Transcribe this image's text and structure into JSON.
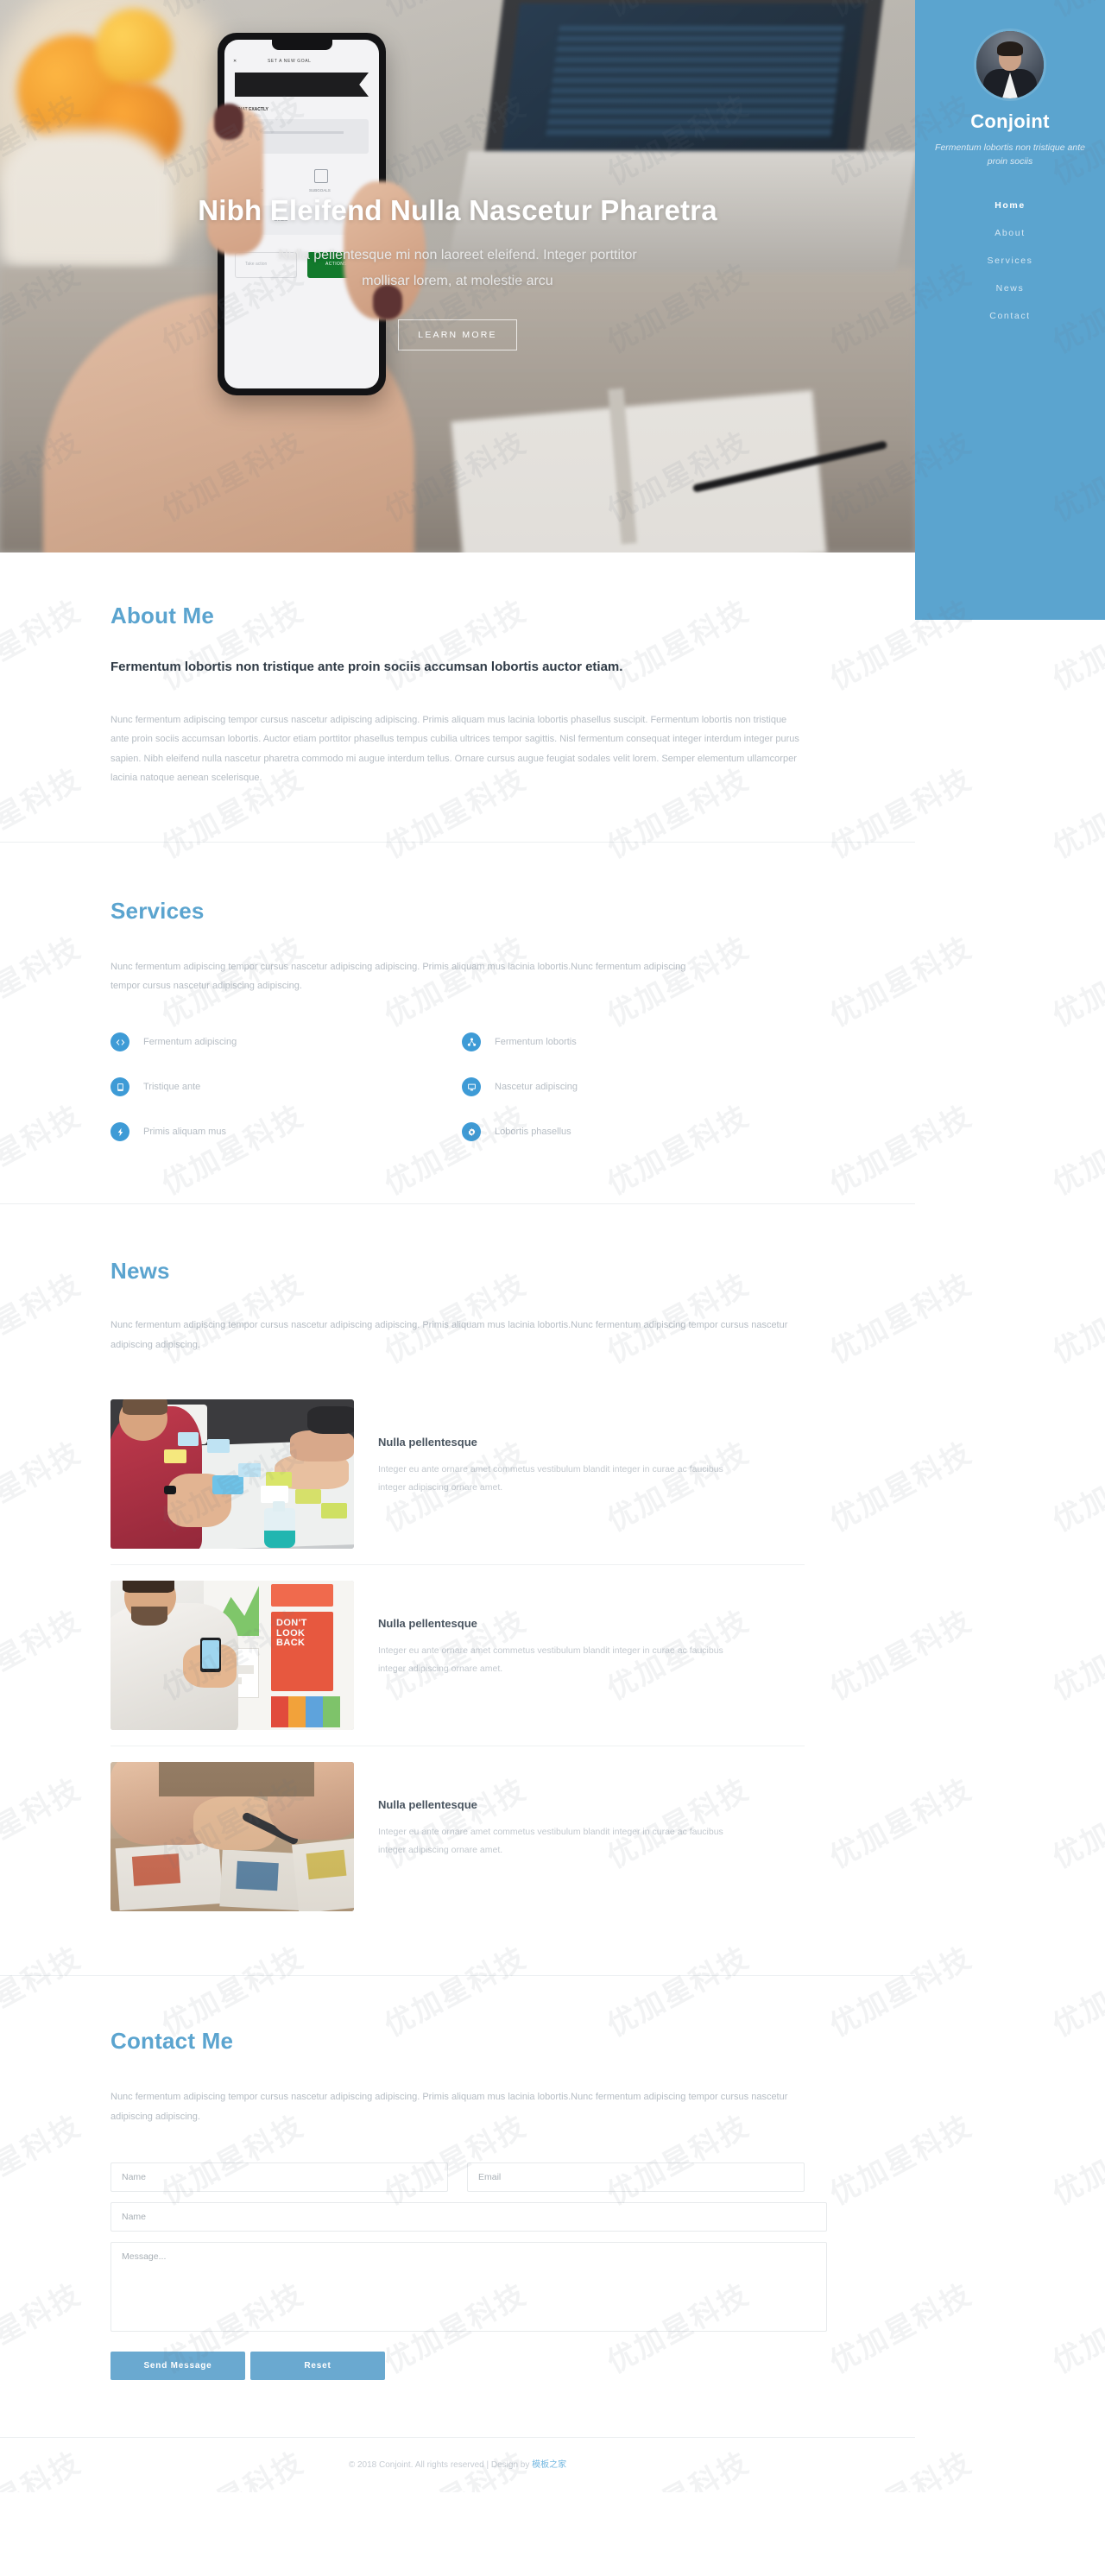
{
  "sidebar": {
    "brand": "Conjoint",
    "tagline": "Fermentum lobortis non tristique ante proin sociis",
    "nav": [
      {
        "label": "Home",
        "active": true
      },
      {
        "label": "About",
        "active": false
      },
      {
        "label": "Services",
        "active": false
      },
      {
        "label": "News",
        "active": false
      },
      {
        "label": "Contact",
        "active": false
      }
    ],
    "avatar_name": "profile-avatar",
    "bg_color": "#5ba4cf"
  },
  "hero": {
    "title": "Nibh Eleifend Nulla Nascetur Pharetra",
    "subtitle": "Nulla pellentesque mi non laoreet eleifend. Integer porttitor mollisar lorem, at molestie arcu",
    "button": "LEARN MORE"
  },
  "about": {
    "title": "About Me",
    "lead": "Fermentum lobortis non tristique ante proin sociis accumsan lobortis auctor etiam.",
    "paragraph": "Nunc fermentum adipiscing tempor cursus nascetur adipiscing adipiscing. Primis aliquam mus lacinia lobortis phasellus suscipit. Fermentum lobortis non tristique ante proin sociis accumsan lobortis. Auctor etiam porttitor phasellus tempus cubilia ultrices tempor sagittis. Nisl fermentum consequat integer interdum integer purus sapien. Nibh eleifend nulla nascetur pharetra commodo mi augue interdum tellus. Ornare cursus augue feugiat sodales velit lorem. Semper elementum ullamcorper lacinia natoque aenean scelerisque."
  },
  "services": {
    "title": "Services",
    "paragraph": "Nunc fermentum adipiscing tempor cursus nascetur adipiscing adipiscing. Primis aliquam mus lacinia lobortis.Nunc fermentum adipiscing tempor cursus nascetur adipiscing adipiscing.",
    "accent": "#3e9bd6",
    "items": [
      {
        "label": "Fermentum adipiscing",
        "icon": "code-icon"
      },
      {
        "label": "Fermentum lobortis",
        "icon": "share-nodes-icon"
      },
      {
        "label": "Tristique ante",
        "icon": "tablet-icon"
      },
      {
        "label": "Nascetur adipiscing",
        "icon": "desktop-icon"
      },
      {
        "label": "Primis aliquam mus",
        "icon": "bolt-icon"
      },
      {
        "label": "Lobortis phasellus",
        "icon": "gear-icon"
      }
    ]
  },
  "news": {
    "title": "News",
    "paragraph": "Nunc fermentum adipiscing tempor cursus nascetur adipiscing adipiscing. Primis aliquam mus lacinia lobortis.Nunc fermentum adipiscing tempor cursus nascetur adipiscing adipiscing.",
    "items": [
      {
        "heading": "Nulla pellentesque",
        "text": "Integer eu ante ornare amet commetus vestibulum blandit integer in curae ac faucibus integer adipiscing ornare amet.",
        "thumb": "workshop-sticky-notes-photo"
      },
      {
        "heading": "Nulla pellentesque",
        "text": "Integer eu ante ornare amet commetus vestibulum blandit integer in curae ac faucibus integer adipiscing ornare amet.",
        "thumb": "dont-look-back-poster-photo"
      },
      {
        "heading": "Nulla pellentesque",
        "text": "Integer eu ante ornare amet commetus vestibulum blandit integer in curae ac faucibus integer adipiscing ornare amet.",
        "thumb": "designer-desk-photo"
      }
    ]
  },
  "contact": {
    "title": "Contact Me",
    "paragraph": "Nunc fermentum adipiscing tempor cursus nascetur adipiscing adipiscing. Primis aliquam mus lacinia lobortis.Nunc fermentum adipiscing tempor cursus nascetur adipiscing adipiscing.",
    "fields": {
      "name_placeholder": "Name",
      "email_placeholder": "Email",
      "subject_placeholder": "Name",
      "message_placeholder": "Message...",
      "name_value": "",
      "email_value": "",
      "subject_value": "",
      "message_value": ""
    },
    "send_label": "Send Message",
    "reset_label": "Reset",
    "button_color": "#6aa9d0"
  },
  "footer": {
    "copyright": "© 2018 Conjoint. All rights reserved | Design by ",
    "design_link": "模板之家"
  },
  "watermark": {
    "text": "优加星科技"
  }
}
